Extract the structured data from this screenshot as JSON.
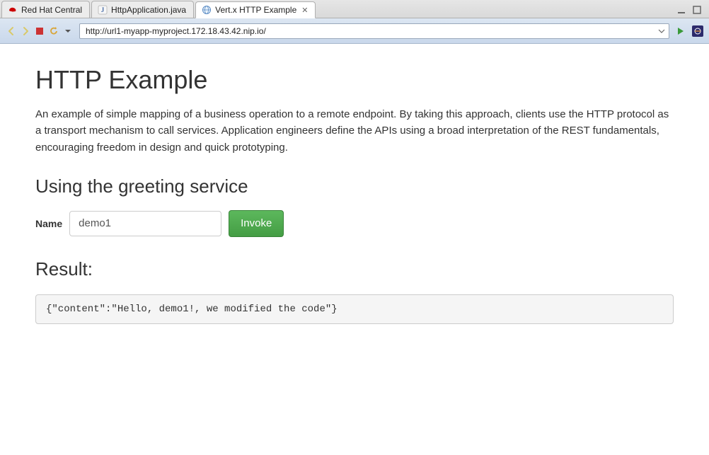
{
  "tabs": [
    {
      "label": "Red Hat Central",
      "icon": "redhat-icon"
    },
    {
      "label": "HttpApplication.java",
      "icon": "java-icon"
    },
    {
      "label": "Vert.x HTTP Example",
      "icon": "globe-icon"
    }
  ],
  "activeTabIndex": 2,
  "toolbar": {
    "url": "http://url1-myapp-myproject.172.18.43.42.nip.io/"
  },
  "page": {
    "title": "HTTP Example",
    "description": "An example of simple mapping of a business operation to a remote endpoint. By taking this approach, clients use the HTTP protocol as a transport mechanism to call services. Application engineers define the APIs using a broad interpretation of the REST fundamentals, encouraging freedom in design and quick prototyping.",
    "section_title": "Using the greeting service",
    "form": {
      "name_label": "Name",
      "name_value": "demo1",
      "invoke_label": "Invoke"
    },
    "result_title": "Result:",
    "result_body": "{\"content\":\"Hello, demo1!, we modified the code\"}"
  }
}
